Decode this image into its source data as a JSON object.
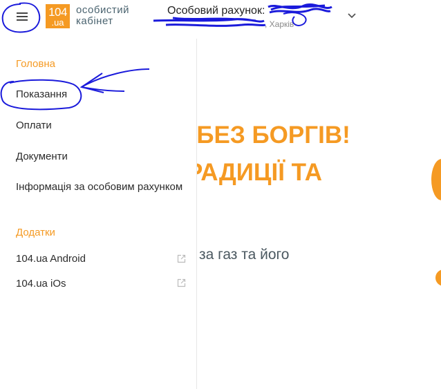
{
  "header": {
    "logo_top": "104",
    "logo_bottom": ".ua",
    "logo_line1": "особистий",
    "logo_line2": "кабінет",
    "account_label": "Особовий рахунок:",
    "account_city": ", Харків"
  },
  "sidebar": {
    "section_main": "Головна",
    "items": [
      {
        "label": "Показання"
      },
      {
        "label": "Оплати"
      },
      {
        "label": "Документи"
      },
      {
        "label": "Інформація за особовим рахунком"
      }
    ],
    "section_apps": "Додатки",
    "apps": [
      {
        "label": "104.ua Android"
      },
      {
        "label": "104.ua iOs"
      }
    ]
  },
  "content": {
    "hero_line1": "- БЕЗ БОРГІВ!",
    "hero_line2": "РАДИЦІЇ ТА",
    "subtitle": "за газ та його"
  },
  "colors": {
    "accent": "#f59a23",
    "annotation": "#1a1adb",
    "text": "#2b2b2b"
  },
  "icons": {
    "menu": "hamburger-icon",
    "chevron": "chevron-down-icon",
    "external": "external-link-icon"
  }
}
